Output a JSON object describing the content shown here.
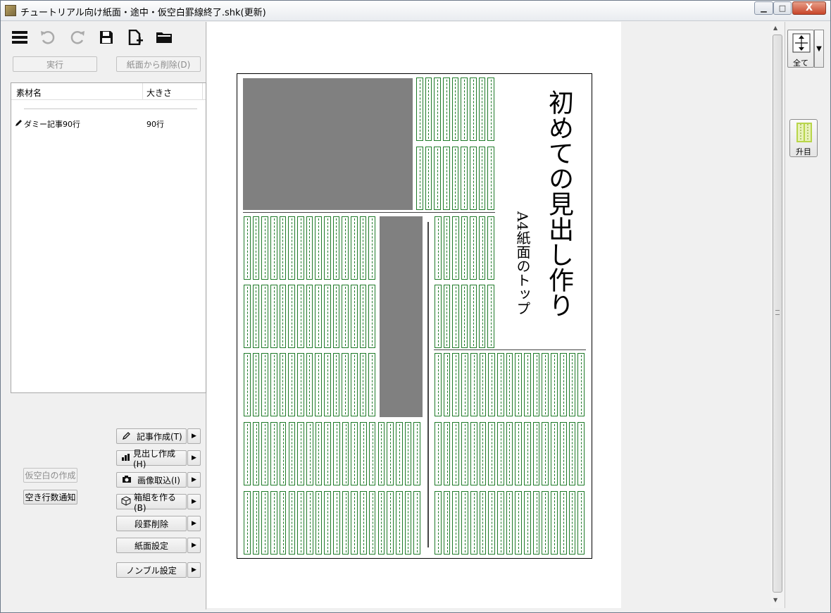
{
  "window": {
    "title": "チュートリアル向け紙面・途中・仮空白罫線終了.shk(更新)",
    "min_label": "▁",
    "max_label": "□",
    "close_label": "X"
  },
  "toolbar": {
    "icons": [
      "menu-icon",
      "undo-icon",
      "redo-icon",
      "save-icon",
      "new-file-icon",
      "open-folder-icon"
    ],
    "run_label": "実行",
    "remove_label": "紙面から削除(D)"
  },
  "material_list": {
    "columns": [
      "素材名",
      "大きさ"
    ],
    "rows": [
      {
        "name": "ダミー記事90行",
        "size": "90行"
      }
    ]
  },
  "side_buttons": {
    "create_article": "記事作成(T)",
    "create_headline": "見出し作成(H)",
    "import_image": "画像取込(I)",
    "make_box": "箱組を作る(B)",
    "delete_rule": "段罫削除",
    "page_settings": "紙面設定",
    "nombre_settings": "ノンブル設定",
    "temp_blank": "仮空白の作成",
    "empty_lines_notice": "空き行数通知"
  },
  "page": {
    "headline": "初めての見出し作り",
    "subheadline": "A4紙面のトップ"
  },
  "right_panel": {
    "zoom_label": "全て",
    "grid_label": "升目"
  },
  "colors": {
    "grid_green": "#1e7a28",
    "image_gray": "#808080"
  }
}
